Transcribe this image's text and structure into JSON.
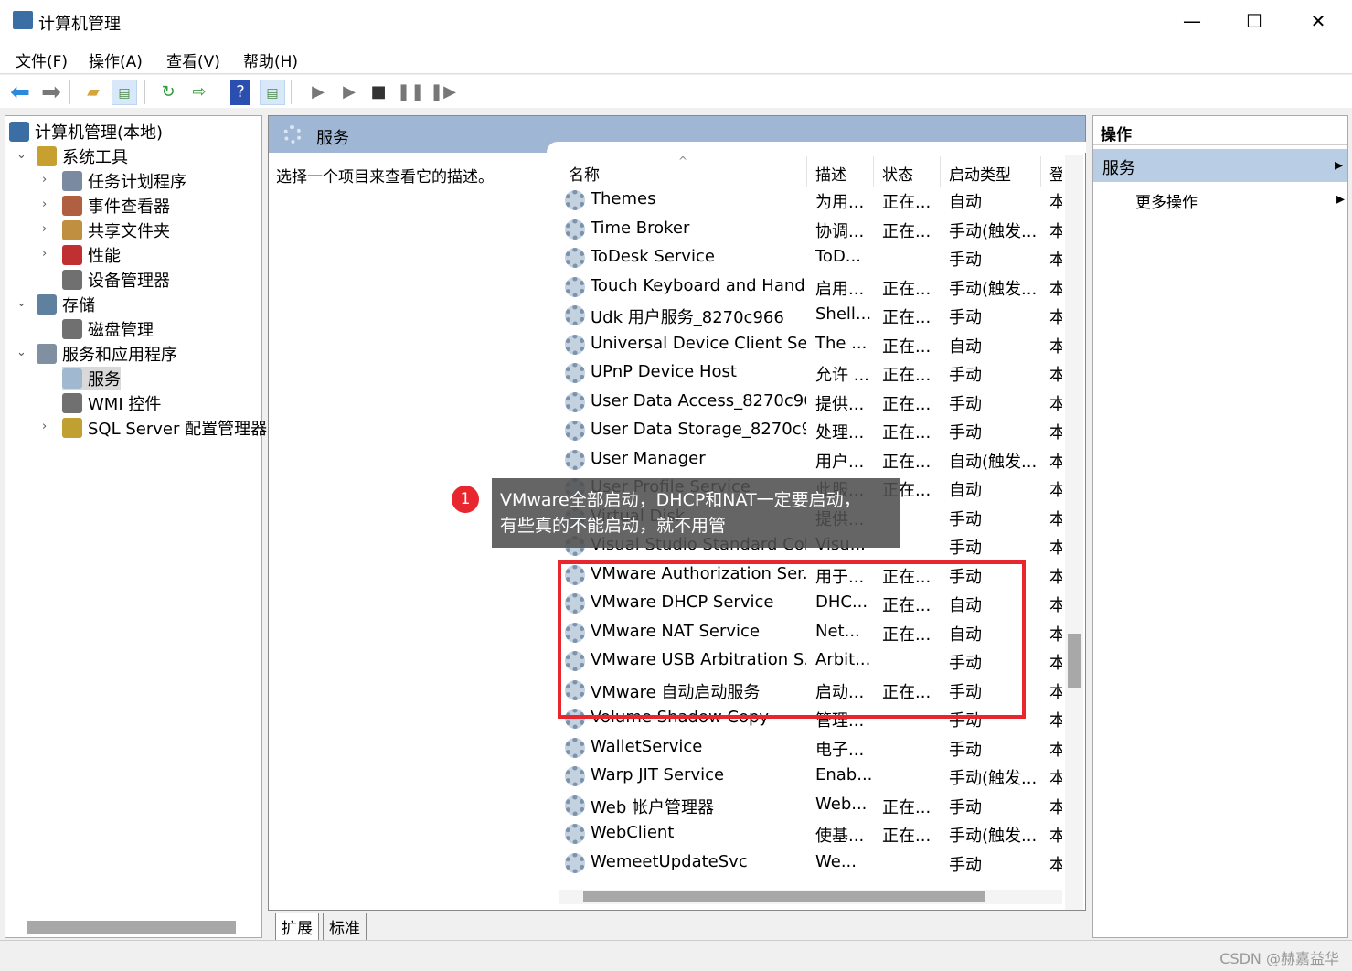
{
  "window": {
    "title": "计算机管理",
    "minimize": "—",
    "maximize": "☐",
    "close": "✕"
  },
  "menu": [
    "文件(F)",
    "操作(A)",
    "查看(V)",
    "帮助(H)"
  ],
  "toolbar": [
    "back-icon",
    "forward-icon",
    "up-folder-icon",
    "show-hide-tree-icon",
    "refresh-icon",
    "export-list-icon",
    "help-icon",
    "show-hide-action-pane-icon",
    "start-service-icon",
    "start-service-alt-icon",
    "stop-service-icon",
    "pause-service-icon",
    "resume-service-icon"
  ],
  "tree": [
    {
      "label": "计算机管理(本地)",
      "level": 0,
      "chev": ""
    },
    {
      "label": "系统工具",
      "level": 1,
      "chev": "⌄"
    },
    {
      "label": "任务计划程序",
      "level": 2,
      "chev": "›"
    },
    {
      "label": "事件查看器",
      "level": 2,
      "chev": "›"
    },
    {
      "label": "共享文件夹",
      "level": 2,
      "chev": "›"
    },
    {
      "label": "性能",
      "level": 2,
      "chev": "›"
    },
    {
      "label": "设备管理器",
      "level": 2,
      "chev": ""
    },
    {
      "label": "存储",
      "level": 1,
      "chev": "⌄"
    },
    {
      "label": "磁盘管理",
      "level": 2,
      "chev": ""
    },
    {
      "label": "服务和应用程序",
      "level": 1,
      "chev": "⌄"
    },
    {
      "label": "服务",
      "level": 2,
      "chev": "",
      "selected": true
    },
    {
      "label": "WMI 控件",
      "level": 2,
      "chev": ""
    },
    {
      "label": "SQL Server 配置管理器",
      "level": 2,
      "chev": "›"
    }
  ],
  "middle": {
    "header": "服务",
    "description": "选择一个项目来查看它的描述。",
    "columns": [
      "名称",
      "描述",
      "状态",
      "启动类型",
      "登"
    ],
    "rows": [
      [
        "Themes",
        "为用...",
        "正在...",
        "自动",
        "本"
      ],
      [
        "Time Broker",
        "协调...",
        "正在...",
        "手动(触发...",
        "本"
      ],
      [
        "ToDesk Service",
        "ToD...",
        "",
        "手动",
        "本"
      ],
      [
        "Touch Keyboard and Hand...",
        "启用...",
        "正在...",
        "手动(触发...",
        "本"
      ],
      [
        "Udk 用户服务_8270c966",
        "Shell...",
        "正在...",
        "手动",
        "本"
      ],
      [
        "Universal Device Client Ser...",
        "The ...",
        "正在...",
        "自动",
        "本"
      ],
      [
        "UPnP Device Host",
        "允许 ...",
        "正在...",
        "手动",
        "本"
      ],
      [
        "User Data Access_8270c966",
        "提供...",
        "正在...",
        "手动",
        "本"
      ],
      [
        "User Data Storage_8270c9...",
        "处理...",
        "正在...",
        "手动",
        "本"
      ],
      [
        "User Manager",
        "用户...",
        "正在...",
        "自动(触发...",
        "本"
      ],
      [
        "User Profile Service",
        "此服...",
        "正在...",
        "自动",
        "本"
      ],
      [
        "Virtual Disk",
        "提供...",
        "",
        "手动",
        "本"
      ],
      [
        "Visual Studio Standard Coll...",
        "Visu...",
        "",
        "手动",
        "本"
      ],
      [
        "VMware Authorization Ser...",
        "用于...",
        "正在...",
        "手动",
        "本"
      ],
      [
        "VMware DHCP Service",
        "DHC...",
        "正在...",
        "自动",
        "本"
      ],
      [
        "VMware NAT Service",
        "Net...",
        "正在...",
        "自动",
        "本"
      ],
      [
        "VMware USB Arbitration S...",
        "Arbit...",
        "",
        "手动",
        "本"
      ],
      [
        "VMware 自动启动服务",
        "启动...",
        "正在...",
        "手动",
        "本"
      ],
      [
        "Volume Shadow Copy",
        "管理...",
        "",
        "手动",
        "本"
      ],
      [
        "WalletService",
        "电子...",
        "",
        "手动",
        "本"
      ],
      [
        "Warp JIT Service",
        "Enab...",
        "",
        "手动(触发...",
        "本"
      ],
      [
        "Web 帐户管理器",
        "Web...",
        "正在...",
        "手动",
        "本"
      ],
      [
        "WebClient",
        "使基...",
        "正在...",
        "手动(触发...",
        "本"
      ],
      [
        "WemeetUpdateSvc",
        "We...",
        "",
        "手动",
        "本"
      ]
    ],
    "tabs": [
      "扩展",
      "标准"
    ]
  },
  "annotation": {
    "badge": "1",
    "text_line1": "VMware全部启动，DHCP和NAT一定要启动，",
    "text_line2": "有些真的不能启动，就不用管",
    "highlight_color": "#e8262d"
  },
  "actions": {
    "title": "操作",
    "section": "服务",
    "section_arrow": "▸",
    "more": "更多操作",
    "more_arrow": "▸"
  },
  "watermark": "CSDN @赫嘉益华"
}
